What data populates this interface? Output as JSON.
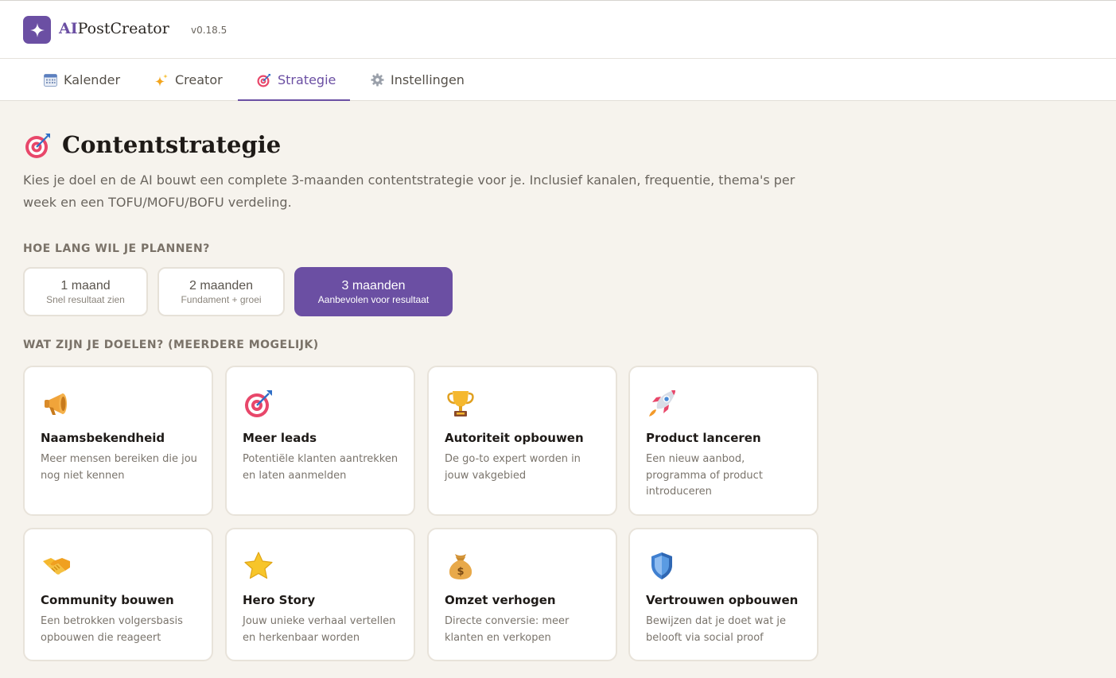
{
  "app": {
    "brand_ai": "AI",
    "brand_rest": "PostCreator",
    "version": "v0.18.5",
    "accent_color": "#6b4fa3"
  },
  "tabs": [
    {
      "label": "Kalender",
      "icon": "calendar-icon"
    },
    {
      "label": "Creator",
      "icon": "sparkles-icon"
    },
    {
      "label": "Strategie",
      "icon": "target-icon",
      "active": true
    },
    {
      "label": "Instellingen",
      "icon": "gear-icon"
    }
  ],
  "page": {
    "title": "Contentstrategie",
    "title_icon": "target-icon",
    "intro": "Kies je doel en de AI bouwt een complete 3-maanden contentstrategie voor je. Inclusief kanalen, frequentie, thema's per week en een TOFU/MOFU/BOFU verdeling."
  },
  "duration": {
    "label": "HOE LANG WIL JE PLANNEN?",
    "options": [
      {
        "title": "1 maand",
        "subtitle": "Snel resultaat zien",
        "selected": false
      },
      {
        "title": "2 maanden",
        "subtitle": "Fundament + groei",
        "selected": false
      },
      {
        "title": "3 maanden",
        "subtitle": "Aanbevolen voor resultaat",
        "selected": true
      }
    ]
  },
  "goals": {
    "label": "WAT ZIJN JE DOELEN? (MEERDERE MOGELIJK)",
    "items": [
      {
        "title": "Naamsbekendheid",
        "desc": "Meer mensen bereiken die jou nog niet kennen",
        "icon": "megaphone-icon"
      },
      {
        "title": "Meer leads",
        "desc": "Potentiële klanten aantrekken en laten aanmelden",
        "icon": "target-icon"
      },
      {
        "title": "Autoriteit opbouwen",
        "desc": "De go-to expert worden in jouw vakgebied",
        "icon": "trophy-icon"
      },
      {
        "title": "Product lanceren",
        "desc": "Een nieuw aanbod, programma of product introduceren",
        "icon": "rocket-icon"
      },
      {
        "title": "Community bouwen",
        "desc": "Een betrokken volgersbasis opbouwen die reageert",
        "icon": "handshake-icon"
      },
      {
        "title": "Hero Story",
        "desc": "Jouw unieke verhaal vertellen en herkenbaar worden",
        "icon": "star-icon"
      },
      {
        "title": "Omzet verhogen",
        "desc": "Directe conversie: meer klanten en verkopen",
        "icon": "money-bag-icon"
      },
      {
        "title": "Vertrouwen opbouwen",
        "desc": "Bewijzen dat je doet wat je belooft via social proof",
        "icon": "shield-icon"
      }
    ]
  }
}
